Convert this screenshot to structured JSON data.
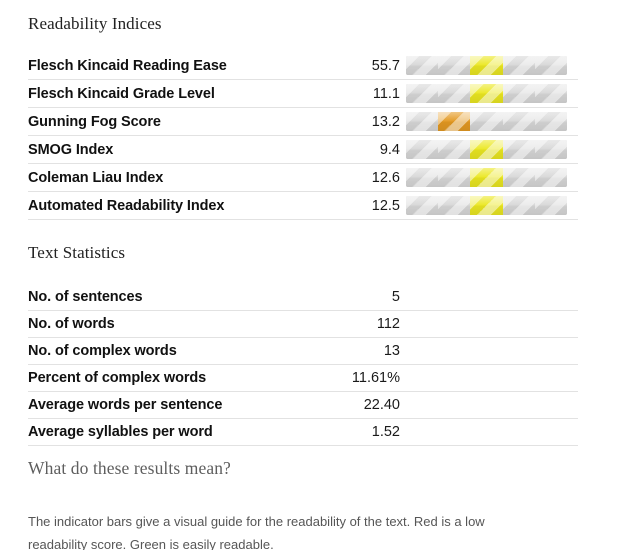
{
  "sections": {
    "readability_title": "Readability Indices",
    "textstats_title": "Text Statistics",
    "explain_title": "What do these results mean?",
    "explain_text": "The indicator bars give a visual guide for the readability of the text. Red is a low readability score. Green is easily readable."
  },
  "colors": {
    "bar_track": "#d2d2d2",
    "bar_empty": "#d2d2d2",
    "highlight_yellow": "#e8e400",
    "highlight_orange": "#e08a00",
    "separator": "#e2e2e2",
    "text": "#111111",
    "muted_text": "#565656",
    "page_background": "#ffffff"
  },
  "indicator_legend": {
    "segments_per_bar": 5,
    "low_color": "#e08a00",
    "mid_color": "#e8e400",
    "empty_color": "#d2d2d2"
  },
  "readability_indices": [
    {
      "label": "Flesch Kincaid Reading Ease",
      "value": "55.7",
      "bar": {
        "active_segment": 3,
        "segments": 5,
        "color": "#e8e400"
      }
    },
    {
      "label": "Flesch Kincaid Grade Level",
      "value": "11.1",
      "bar": {
        "active_segment": 3,
        "segments": 5,
        "color": "#e8e400"
      }
    },
    {
      "label": "Gunning Fog Score",
      "value": "13.2",
      "bar": {
        "active_segment": 2,
        "segments": 5,
        "color": "#e08a00"
      }
    },
    {
      "label": "SMOG Index",
      "value": "9.4",
      "bar": {
        "active_segment": 3,
        "segments": 5,
        "color": "#e8e400"
      }
    },
    {
      "label": "Coleman Liau Index",
      "value": "12.6",
      "bar": {
        "active_segment": 3,
        "segments": 5,
        "color": "#e8e400"
      }
    },
    {
      "label": "Automated Readability Index",
      "value": "12.5",
      "bar": {
        "active_segment": 3,
        "segments": 5,
        "color": "#e8e400"
      }
    }
  ],
  "text_statistics": [
    {
      "label": "No. of sentences",
      "value": "5"
    },
    {
      "label": "No. of words",
      "value": "112"
    },
    {
      "label": "No. of complex words",
      "value": "13"
    },
    {
      "label": "Percent of complex words",
      "value": "11.61%"
    },
    {
      "label": "Average words per sentence",
      "value": "22.40"
    },
    {
      "label": "Average syllables per word",
      "value": "1.52"
    }
  ]
}
